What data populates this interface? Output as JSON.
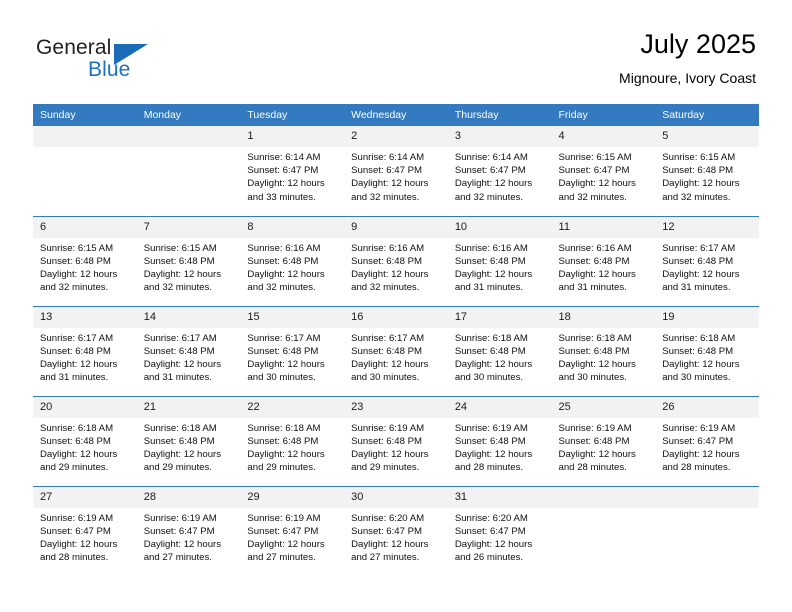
{
  "brand": {
    "name_part1": "General",
    "name_part2": "Blue"
  },
  "header": {
    "title": "July 2025",
    "subtitle": "Mignoure, Ivory Coast"
  },
  "colors": {
    "header_blue": "#337AC0",
    "brand_blue": "#1C71C0",
    "daynum_bg": "#F2F2F2"
  },
  "weekday_headers": [
    "Sunday",
    "Monday",
    "Tuesday",
    "Wednesday",
    "Thursday",
    "Friday",
    "Saturday"
  ],
  "weeks": [
    [
      {
        "day": "",
        "sunrise": "",
        "sunset": "",
        "daylight1": "",
        "daylight2": "",
        "empty": true
      },
      {
        "day": "",
        "sunrise": "",
        "sunset": "",
        "daylight1": "",
        "daylight2": "",
        "empty": true
      },
      {
        "day": "1",
        "sunrise": "Sunrise: 6:14 AM",
        "sunset": "Sunset: 6:47 PM",
        "daylight1": "Daylight: 12 hours",
        "daylight2": "and 33 minutes."
      },
      {
        "day": "2",
        "sunrise": "Sunrise: 6:14 AM",
        "sunset": "Sunset: 6:47 PM",
        "daylight1": "Daylight: 12 hours",
        "daylight2": "and 32 minutes."
      },
      {
        "day": "3",
        "sunrise": "Sunrise: 6:14 AM",
        "sunset": "Sunset: 6:47 PM",
        "daylight1": "Daylight: 12 hours",
        "daylight2": "and 32 minutes."
      },
      {
        "day": "4",
        "sunrise": "Sunrise: 6:15 AM",
        "sunset": "Sunset: 6:47 PM",
        "daylight1": "Daylight: 12 hours",
        "daylight2": "and 32 minutes."
      },
      {
        "day": "5",
        "sunrise": "Sunrise: 6:15 AM",
        "sunset": "Sunset: 6:48 PM",
        "daylight1": "Daylight: 12 hours",
        "daylight2": "and 32 minutes."
      }
    ],
    [
      {
        "day": "6",
        "sunrise": "Sunrise: 6:15 AM",
        "sunset": "Sunset: 6:48 PM",
        "daylight1": "Daylight: 12 hours",
        "daylight2": "and 32 minutes."
      },
      {
        "day": "7",
        "sunrise": "Sunrise: 6:15 AM",
        "sunset": "Sunset: 6:48 PM",
        "daylight1": "Daylight: 12 hours",
        "daylight2": "and 32 minutes."
      },
      {
        "day": "8",
        "sunrise": "Sunrise: 6:16 AM",
        "sunset": "Sunset: 6:48 PM",
        "daylight1": "Daylight: 12 hours",
        "daylight2": "and 32 minutes."
      },
      {
        "day": "9",
        "sunrise": "Sunrise: 6:16 AM",
        "sunset": "Sunset: 6:48 PM",
        "daylight1": "Daylight: 12 hours",
        "daylight2": "and 32 minutes."
      },
      {
        "day": "10",
        "sunrise": "Sunrise: 6:16 AM",
        "sunset": "Sunset: 6:48 PM",
        "daylight1": "Daylight: 12 hours",
        "daylight2": "and 31 minutes."
      },
      {
        "day": "11",
        "sunrise": "Sunrise: 6:16 AM",
        "sunset": "Sunset: 6:48 PM",
        "daylight1": "Daylight: 12 hours",
        "daylight2": "and 31 minutes."
      },
      {
        "day": "12",
        "sunrise": "Sunrise: 6:17 AM",
        "sunset": "Sunset: 6:48 PM",
        "daylight1": "Daylight: 12 hours",
        "daylight2": "and 31 minutes."
      }
    ],
    [
      {
        "day": "13",
        "sunrise": "Sunrise: 6:17 AM",
        "sunset": "Sunset: 6:48 PM",
        "daylight1": "Daylight: 12 hours",
        "daylight2": "and 31 minutes."
      },
      {
        "day": "14",
        "sunrise": "Sunrise: 6:17 AM",
        "sunset": "Sunset: 6:48 PM",
        "daylight1": "Daylight: 12 hours",
        "daylight2": "and 31 minutes."
      },
      {
        "day": "15",
        "sunrise": "Sunrise: 6:17 AM",
        "sunset": "Sunset: 6:48 PM",
        "daylight1": "Daylight: 12 hours",
        "daylight2": "and 30 minutes."
      },
      {
        "day": "16",
        "sunrise": "Sunrise: 6:17 AM",
        "sunset": "Sunset: 6:48 PM",
        "daylight1": "Daylight: 12 hours",
        "daylight2": "and 30 minutes."
      },
      {
        "day": "17",
        "sunrise": "Sunrise: 6:18 AM",
        "sunset": "Sunset: 6:48 PM",
        "daylight1": "Daylight: 12 hours",
        "daylight2": "and 30 minutes."
      },
      {
        "day": "18",
        "sunrise": "Sunrise: 6:18 AM",
        "sunset": "Sunset: 6:48 PM",
        "daylight1": "Daylight: 12 hours",
        "daylight2": "and 30 minutes."
      },
      {
        "day": "19",
        "sunrise": "Sunrise: 6:18 AM",
        "sunset": "Sunset: 6:48 PM",
        "daylight1": "Daylight: 12 hours",
        "daylight2": "and 30 minutes."
      }
    ],
    [
      {
        "day": "20",
        "sunrise": "Sunrise: 6:18 AM",
        "sunset": "Sunset: 6:48 PM",
        "daylight1": "Daylight: 12 hours",
        "daylight2": "and 29 minutes."
      },
      {
        "day": "21",
        "sunrise": "Sunrise: 6:18 AM",
        "sunset": "Sunset: 6:48 PM",
        "daylight1": "Daylight: 12 hours",
        "daylight2": "and 29 minutes."
      },
      {
        "day": "22",
        "sunrise": "Sunrise: 6:18 AM",
        "sunset": "Sunset: 6:48 PM",
        "daylight1": "Daylight: 12 hours",
        "daylight2": "and 29 minutes."
      },
      {
        "day": "23",
        "sunrise": "Sunrise: 6:19 AM",
        "sunset": "Sunset: 6:48 PM",
        "daylight1": "Daylight: 12 hours",
        "daylight2": "and 29 minutes."
      },
      {
        "day": "24",
        "sunrise": "Sunrise: 6:19 AM",
        "sunset": "Sunset: 6:48 PM",
        "daylight1": "Daylight: 12 hours",
        "daylight2": "and 28 minutes."
      },
      {
        "day": "25",
        "sunrise": "Sunrise: 6:19 AM",
        "sunset": "Sunset: 6:48 PM",
        "daylight1": "Daylight: 12 hours",
        "daylight2": "and 28 minutes."
      },
      {
        "day": "26",
        "sunrise": "Sunrise: 6:19 AM",
        "sunset": "Sunset: 6:47 PM",
        "daylight1": "Daylight: 12 hours",
        "daylight2": "and 28 minutes."
      }
    ],
    [
      {
        "day": "27",
        "sunrise": "Sunrise: 6:19 AM",
        "sunset": "Sunset: 6:47 PM",
        "daylight1": "Daylight: 12 hours",
        "daylight2": "and 28 minutes."
      },
      {
        "day": "28",
        "sunrise": "Sunrise: 6:19 AM",
        "sunset": "Sunset: 6:47 PM",
        "daylight1": "Daylight: 12 hours",
        "daylight2": "and 27 minutes."
      },
      {
        "day": "29",
        "sunrise": "Sunrise: 6:19 AM",
        "sunset": "Sunset: 6:47 PM",
        "daylight1": "Daylight: 12 hours",
        "daylight2": "and 27 minutes."
      },
      {
        "day": "30",
        "sunrise": "Sunrise: 6:20 AM",
        "sunset": "Sunset: 6:47 PM",
        "daylight1": "Daylight: 12 hours",
        "daylight2": "and 27 minutes."
      },
      {
        "day": "31",
        "sunrise": "Sunrise: 6:20 AM",
        "sunset": "Sunset: 6:47 PM",
        "daylight1": "Daylight: 12 hours",
        "daylight2": "and 26 minutes."
      },
      {
        "day": "",
        "sunrise": "",
        "sunset": "",
        "daylight1": "",
        "daylight2": "",
        "empty": true
      },
      {
        "day": "",
        "sunrise": "",
        "sunset": "",
        "daylight1": "",
        "daylight2": "",
        "empty": true
      }
    ]
  ]
}
